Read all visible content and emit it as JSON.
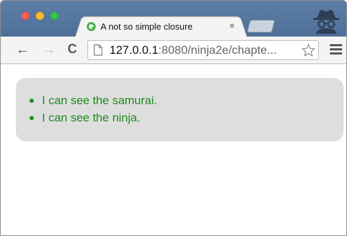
{
  "browser": {
    "tab": {
      "title": "A not so simple closure",
      "close_glyph": "×"
    },
    "toolbar": {
      "back_glyph": "←",
      "forward_glyph": "→",
      "reload_glyph": "C",
      "url_host": "127.0.0.1",
      "url_rest": ":8080/ninja2e/chapte..."
    },
    "colors": {
      "tabstrip": "#5577a0",
      "pass_text": "#1d8a1d",
      "results_bg": "#dedede"
    }
  },
  "page": {
    "results": [
      {
        "text": "I can see the samurai."
      },
      {
        "text": "I can see the ninja."
      }
    ]
  }
}
